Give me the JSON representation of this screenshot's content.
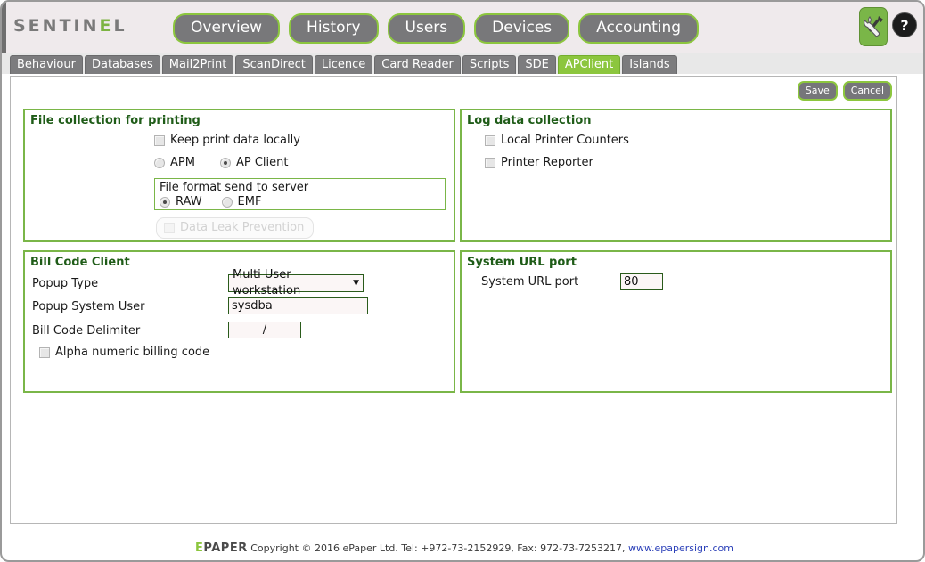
{
  "header": {
    "logo_prefix": "S",
    "logo_text_a": "SENTIN",
    "logo_text_green": "E",
    "logo_text_b": "L",
    "nav": [
      {
        "label": "Overview"
      },
      {
        "label": "History"
      },
      {
        "label": "Users"
      },
      {
        "label": "Devices"
      },
      {
        "label": "Accounting"
      }
    ],
    "tools_icon": "tools-icon",
    "help_icon": "help-icon"
  },
  "tabs": [
    {
      "label": "Behaviour",
      "active": false
    },
    {
      "label": "Databases",
      "active": false
    },
    {
      "label": "Mail2Print",
      "active": false
    },
    {
      "label": "ScanDirect",
      "active": false
    },
    {
      "label": "Licence",
      "active": false
    },
    {
      "label": "Card Reader",
      "active": false
    },
    {
      "label": "Scripts",
      "active": false
    },
    {
      "label": "SDE",
      "active": false
    },
    {
      "label": "APClient",
      "active": true
    },
    {
      "label": "Islands",
      "active": false
    }
  ],
  "actions": {
    "save_label": "Save",
    "cancel_label": "Cancel"
  },
  "file_collection": {
    "title": "File collection for printing",
    "keep_local_label": "Keep print data locally",
    "keep_local_checked": false,
    "mode_apm_label": "APM",
    "mode_apclient_label": "AP Client",
    "mode_selected": "AP Client",
    "fileformat_title": "File format send to server",
    "fileformat_raw_label": "RAW",
    "fileformat_emf_label": "EMF",
    "fileformat_selected": "RAW",
    "dlp_label": "Data Leak Prevention",
    "dlp_checked": false,
    "dlp_disabled": true
  },
  "log_data": {
    "title": "Log data collection",
    "local_printer_counters_label": "Local Printer Counters",
    "local_printer_counters_checked": false,
    "printer_reporter_label": "Printer Reporter",
    "printer_reporter_checked": false
  },
  "bill_code": {
    "title": "Bill Code Client",
    "popup_type_label": "Popup Type",
    "popup_type_value": "Multi User workstation",
    "popup_user_label": "Popup System User",
    "popup_user_value": "sysdba",
    "delimiter_label": "Bill Code Delimiter",
    "delimiter_value": "/",
    "alpha_numeric_label": "Alpha numeric billing code",
    "alpha_numeric_checked": false
  },
  "system_url": {
    "title": "System URL port",
    "port_label": "System URL port",
    "port_value": "80"
  },
  "footer": {
    "brand_green": "E",
    "brand_rest": "PAPER",
    "text": "Copyright © 2016 ePaper Ltd. Tel: +972-73-2152929, Fax: 972-73-7253217,",
    "link": "www.epapersign.com"
  },
  "colors": {
    "accent_green": "#8cc63e",
    "panel_green": "#7ab648",
    "nav_gray": "#78787a",
    "header_bg": "#efeaec",
    "title_green": "#1f5c18"
  }
}
